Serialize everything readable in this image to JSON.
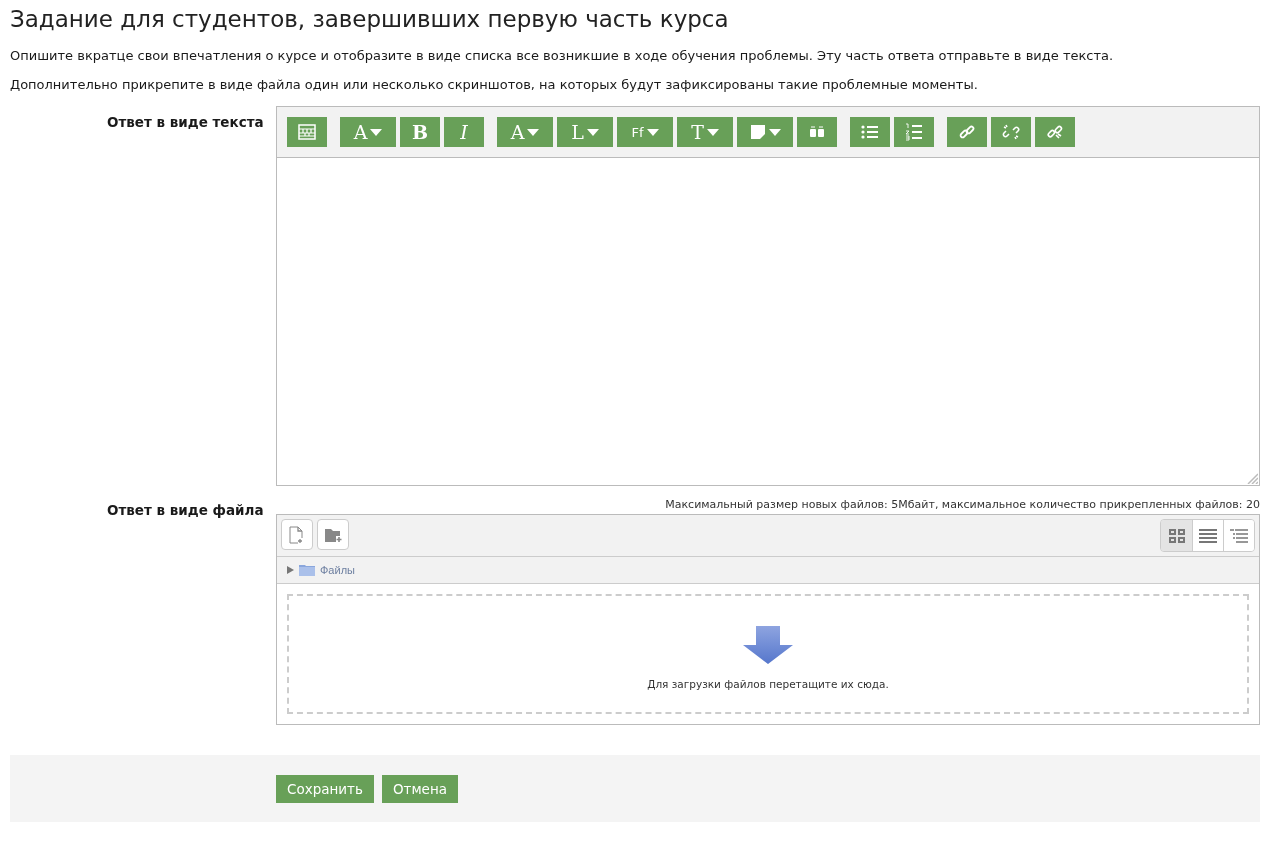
{
  "title": "Задание для студентов, завершивших первую часть курса",
  "intro": [
    "Опишите вкратце свои впечатления о курсе и отобразите в виде списка все возникшие в ходе обучения проблемы. Эту часть ответа отправьте в виде текста.",
    "Дополнительно прикрепите в виде файла один или несколько скриншотов, на которых будут зафиксированы такие проблемные моменты."
  ],
  "text_answer": {
    "label": "Ответ в виде текста",
    "toolbar": [
      [
        {
          "kind": "table",
          "dropdown": false
        }
      ],
      [
        {
          "kind": "glyph",
          "glyph": "A",
          "dropdown": true
        },
        {
          "kind": "bold",
          "glyph": "B",
          "dropdown": false
        },
        {
          "kind": "italic",
          "glyph": "I",
          "dropdown": false
        }
      ],
      [
        {
          "kind": "glyph",
          "glyph": "A",
          "dropdown": true
        },
        {
          "kind": "glyph",
          "glyph": "L",
          "dropdown": true
        },
        {
          "kind": "font",
          "glyph": "Ff",
          "dropdown": true
        },
        {
          "kind": "glyph",
          "glyph": "T",
          "dropdown": true
        },
        {
          "kind": "note",
          "dropdown": true
        },
        {
          "kind": "special",
          "dropdown": false
        }
      ],
      [
        {
          "kind": "bullets",
          "dropdown": false
        },
        {
          "kind": "numbers",
          "dropdown": false
        }
      ],
      [
        {
          "kind": "link",
          "dropdown": false
        },
        {
          "kind": "unlink",
          "dropdown": false
        },
        {
          "kind": "anchor",
          "dropdown": false
        }
      ]
    ]
  },
  "file_answer": {
    "label": "Ответ в виде файла",
    "limits": "Максимальный размер новых файлов: 5Мбайт, максимальное количество прикрепленных файлов: 20",
    "views": [
      {
        "kind": "icons",
        "selected": true
      },
      {
        "kind": "list",
        "selected": false
      },
      {
        "kind": "tree",
        "selected": false
      }
    ],
    "folder": "Файлы",
    "drop_hint": "Для загрузки файлов перетащите их сюда."
  },
  "buttons": [
    "Сохранить",
    "Отмена"
  ]
}
